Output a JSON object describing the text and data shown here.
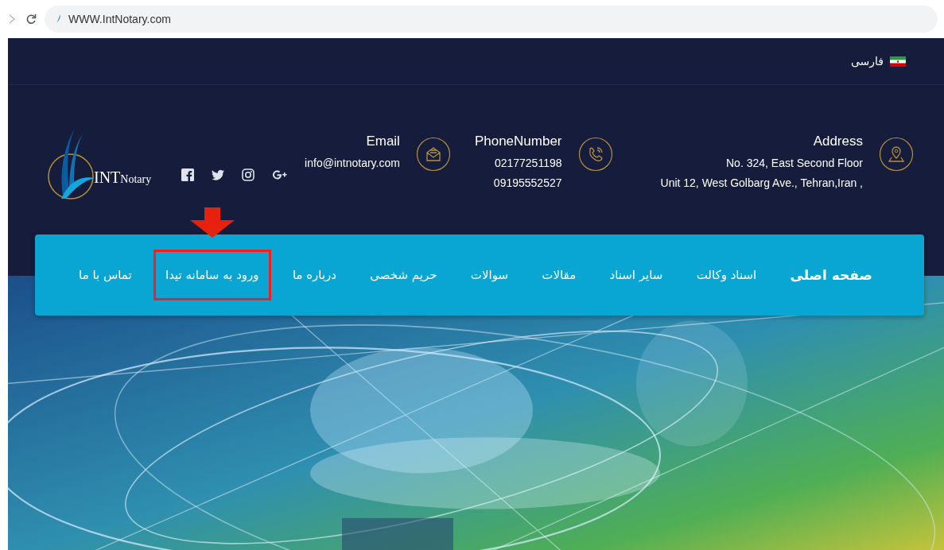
{
  "browser": {
    "url": "WWW.IntNotary.com"
  },
  "language": {
    "label": "فارسی"
  },
  "logo": {
    "main": "INT",
    "sub": "Notary"
  },
  "contacts": [
    {
      "kind": "address",
      "title": "Address",
      "lines": [
        "No. 324, East Second Floor",
        "Unit 12, West Golbarg Ave., Tehran,Iran ,"
      ]
    },
    {
      "kind": "phone",
      "title": "PhoneNumber",
      "lines": [
        "02177251198",
        "09195552527"
      ]
    },
    {
      "kind": "email",
      "title": "Email",
      "lines": [
        "info@intnotary.com"
      ]
    }
  ],
  "nav": [
    {
      "label": "صفحه اصلی",
      "selected": true,
      "highlighted": false
    },
    {
      "label": "اسناد وکالت",
      "selected": false,
      "highlighted": false
    },
    {
      "label": "سایر اسناد",
      "selected": false,
      "highlighted": false
    },
    {
      "label": "مقالات",
      "selected": false,
      "highlighted": false
    },
    {
      "label": "سوالات",
      "selected": false,
      "highlighted": false
    },
    {
      "label": "حریم شخصی",
      "selected": false,
      "highlighted": false
    },
    {
      "label": "درباره ما",
      "selected": false,
      "highlighted": false
    },
    {
      "label": "ورود به سامانه تیدا",
      "selected": false,
      "highlighted": true
    },
    {
      "label": "تماس با ما",
      "selected": false,
      "highlighted": false
    }
  ]
}
